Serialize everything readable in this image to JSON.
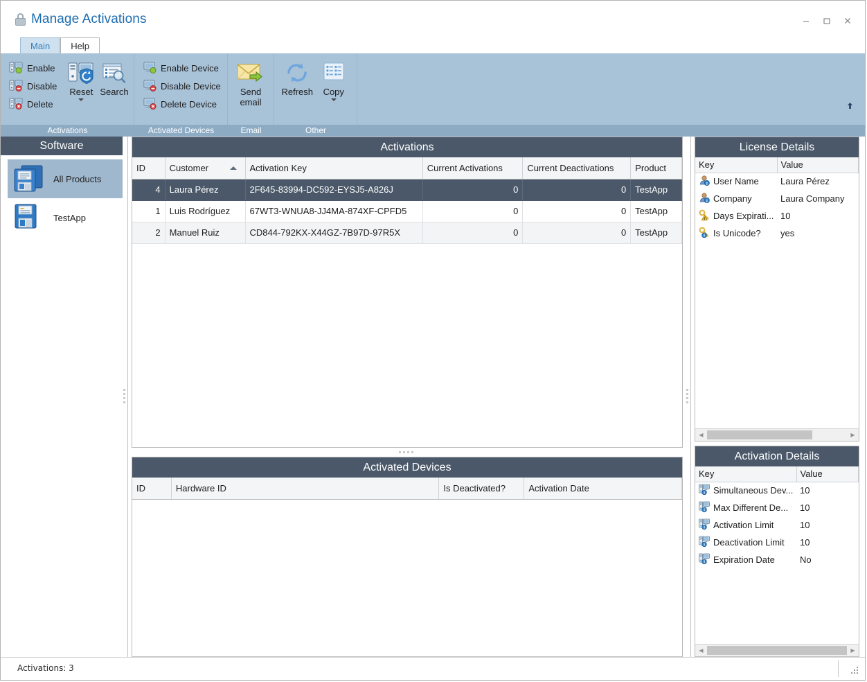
{
  "window": {
    "title": "Manage Activations",
    "title_icon": "lock-icon",
    "minimize_label": "–",
    "maximize_label": "□",
    "close_label": "✕"
  },
  "ribbon": {
    "tabs": [
      {
        "label": "Main",
        "active": true
      },
      {
        "label": "Help",
        "active": false
      }
    ],
    "groups": [
      {
        "label": "Activations",
        "buttons": [
          {
            "label": "Enable",
            "icon": "enable-activation-icon",
            "size": "small"
          },
          {
            "label": "Disable",
            "icon": "disable-activation-icon",
            "size": "small"
          },
          {
            "label": "Delete",
            "icon": "delete-activation-icon",
            "size": "small"
          },
          {
            "label": "Reset",
            "icon": "reset-icon",
            "size": "large",
            "has_menu": true
          },
          {
            "label": "Search",
            "icon": "search-icon",
            "size": "large",
            "has_menu": false
          }
        ]
      },
      {
        "label": "Activated Devices",
        "buttons": [
          {
            "label": "Enable Device",
            "icon": "enable-device-icon",
            "size": "small"
          },
          {
            "label": "Disable Device",
            "icon": "disable-device-icon",
            "size": "small"
          },
          {
            "label": "Delete Device",
            "icon": "delete-device-icon",
            "size": "small"
          }
        ]
      },
      {
        "label": "Email",
        "buttons": [
          {
            "label": "Send email",
            "icon": "send-email-icon",
            "size": "large",
            "has_menu": true
          }
        ]
      },
      {
        "label": "Other",
        "buttons": [
          {
            "label": "Refresh",
            "icon": "refresh-icon",
            "size": "large",
            "has_menu": false
          },
          {
            "label": "Copy",
            "icon": "copy-icon",
            "size": "large",
            "has_menu": true
          }
        ]
      }
    ],
    "collapse_icon": "collapse-ribbon-icon"
  },
  "software_panel": {
    "title": "Software",
    "items": [
      {
        "label": "All Products",
        "icon": "floppy-disk-all-products-icon",
        "selected": true
      },
      {
        "label": "TestApp",
        "icon": "floppy-disk-testapp-icon",
        "selected": false
      }
    ]
  },
  "activations_grid": {
    "title": "Activations",
    "columns": [
      {
        "label": "ID",
        "align": "right",
        "sorted": false
      },
      {
        "label": "Customer",
        "align": "left",
        "sorted": true,
        "sort_dir": "asc"
      },
      {
        "label": "Activation Key",
        "align": "left",
        "sorted": false
      },
      {
        "label": "Current Activations",
        "align": "left",
        "sorted": false
      },
      {
        "label": "Current Deactivations",
        "align": "left",
        "sorted": false
      },
      {
        "label": "Product",
        "align": "left",
        "sorted": false
      }
    ],
    "rows": [
      {
        "id": "4",
        "customer": "Laura Pérez",
        "key": "2F645-83994-DC592-EYSJ5-A826J",
        "current_activations": "0",
        "current_deactivations": "0",
        "product": "TestApp",
        "selected": true
      },
      {
        "id": "1",
        "customer": "Luis Rodríguez",
        "key": "67WT3-WNUA8-JJ4MA-874XF-CPFD5",
        "current_activations": "0",
        "current_deactivations": "0",
        "product": "TestApp",
        "selected": false
      },
      {
        "id": "2",
        "customer": "Manuel Ruiz",
        "key": "CD844-792KX-X44GZ-7B97D-97R5X",
        "current_activations": "0",
        "current_deactivations": "0",
        "product": "TestApp",
        "selected": false
      }
    ]
  },
  "devices_grid": {
    "title": "Activated Devices",
    "columns": [
      {
        "label": "ID"
      },
      {
        "label": "Hardware ID"
      },
      {
        "label": "Is Deactivated?"
      },
      {
        "label": "Activation Date"
      }
    ],
    "rows": []
  },
  "license_details": {
    "title": "License Details",
    "columns": [
      "Key",
      "Value"
    ],
    "rows": [
      {
        "key": "User Name",
        "value": "Laura Pérez",
        "icon": "user-info-icon"
      },
      {
        "key": "Company",
        "value": "Laura Company",
        "icon": "user-info-icon"
      },
      {
        "key": "Days Expirati...",
        "value": "10",
        "icon": "key-warning-icon"
      },
      {
        "key": "Is Unicode?",
        "value": "yes",
        "icon": "key-info-icon"
      }
    ],
    "scrollbar": {
      "left_arrow": "◀",
      "right_arrow": "▶"
    }
  },
  "activation_details": {
    "title": "Activation Details",
    "columns": [
      "Key",
      "Value"
    ],
    "rows": [
      {
        "key": "Simultaneous Dev...",
        "value": "10",
        "icon": "device-info-icon"
      },
      {
        "key": "Max Different De...",
        "value": "10",
        "icon": "device-info-icon"
      },
      {
        "key": "Activation Limit",
        "value": "10",
        "icon": "device-info-icon"
      },
      {
        "key": "Deactivation Limit",
        "value": "10",
        "icon": "device-info-icon"
      },
      {
        "key": "Expiration Date",
        "value": "No",
        "icon": "device-info-icon"
      }
    ],
    "scrollbar": {
      "left_arrow": "◀",
      "right_arrow": "▶"
    }
  },
  "statusbar": {
    "text": "Activations: 3",
    "resize_grip": "resize-grip-icon"
  },
  "colors": {
    "accent_title": "#1b6cb0",
    "ribbon_bg": "#a8c2d8",
    "group_label_bg": "#8eabc4",
    "panel_header_bg": "#4a5869",
    "selection_bg": "#4a5869",
    "sidebar_selected_bg": "#9fb8ce"
  }
}
